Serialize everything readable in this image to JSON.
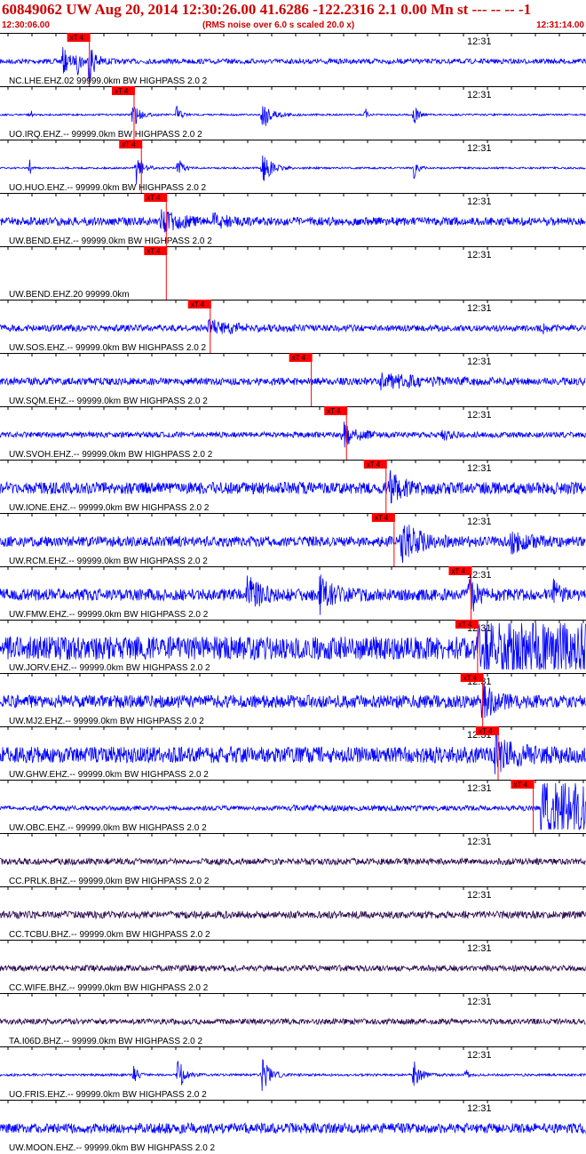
{
  "header": {
    "title": "60849062 UW Aug 20, 2014 12:30:26.00   41.6286 -122.2316  2.1 0.00 Mn st --- -- --  -1",
    "start_time": "12:30:06.00",
    "rms_note": "(RMS noise over 6.0 s scaled 20.0 x)",
    "end_time": "12:31:14.00"
  },
  "colors": {
    "header": "#cc0000",
    "trace": "#0000ff",
    "trace_cc": "#2a0a50",
    "pick": "#ff0000",
    "label": "#000000"
  },
  "chart_data": {
    "type": "line",
    "time_window": [
      "12:30:06.00",
      "12:31:14.00"
    ],
    "time_marker": "12:31",
    "pick_label": "xT 4",
    "traces": [
      {
        "label": "NC.LHE.EHZ.02  99999.0km BW  HIGHPASS  2.0  2",
        "pick_time_s": 12.2,
        "network_color": "trace",
        "noise": 0.11,
        "bursts": [
          [
            8.6,
            0.9,
            0.55
          ],
          [
            10.6,
            0.6,
            0.45
          ],
          [
            12.2,
            0.8,
            0.9
          ]
        ]
      },
      {
        "label": "UO.IRQ.EHZ.--  99999.0km BW  HIGHPASS  2.0  2",
        "pick_time_s": 18.3,
        "network_color": "trace",
        "noise": 0.04,
        "bursts": [
          [
            4.1,
            0.15,
            0.45
          ],
          [
            18.1,
            0.8,
            0.65
          ],
          [
            24.1,
            0.6,
            0.4
          ],
          [
            35.8,
            1.2,
            0.7
          ],
          [
            49.9,
            0.2,
            0.3
          ],
          [
            56.5,
            0.5,
            0.55
          ]
        ]
      },
      {
        "label": "UO.HUO.EHZ.--  99999.0km BW  HIGHPASS  2.0  2",
        "pick_time_s": 19.3,
        "network_color": "trace",
        "noise": 0.04,
        "bursts": [
          [
            4.1,
            0.15,
            0.4
          ],
          [
            18.6,
            0.8,
            0.7
          ],
          [
            24.3,
            0.6,
            0.5
          ],
          [
            35.8,
            1.2,
            0.7
          ],
          [
            56.5,
            0.5,
            0.55
          ]
        ]
      },
      {
        "label": "UW.BEND.EHZ.--  99999.0km BW  HIGHPASS  2.0  2",
        "pick_time_s": 22.7,
        "network_color": "trace",
        "noise": 0.18,
        "bursts": [
          [
            22.1,
            2.0,
            0.55
          ],
          [
            29.2,
            1.5,
            0.32
          ]
        ]
      },
      {
        "label": "UW.BEND.EHZ.20  99999.0km",
        "pick_time_s": 22.7,
        "network_color": "trace",
        "noise": 0.0,
        "bursts": []
      },
      {
        "label": "UW.SOS.EHZ.--  99999.0km BW  HIGHPASS  2.0  2",
        "pick_time_s": 28.7,
        "network_color": "trace",
        "noise": 0.14,
        "bursts": [
          [
            28.5,
            3.5,
            0.28
          ],
          [
            74.0,
            0.6,
            0.2
          ]
        ]
      },
      {
        "label": "UW.SQM.EHZ.--  99999.0km BW  HIGHPASS  2.0  2",
        "pick_time_s": 42.5,
        "network_color": "trace",
        "noise": 0.16,
        "bursts": [
          [
            52.0,
            6.0,
            0.25
          ]
        ]
      },
      {
        "label": "UW.SVOH.EHZ.--  99999.0km BW  HIGHPASS  2.0  2",
        "pick_time_s": 47.3,
        "network_color": "trace",
        "noise": 0.12,
        "bursts": [
          [
            46.8,
            1.6,
            0.6
          ],
          [
            60.5,
            1.0,
            0.2
          ]
        ]
      },
      {
        "label": "UW.IONE.EHZ.--  99999.0km BW  HIGHPASS  2.0  2",
        "pick_time_s": 52.7,
        "network_color": "trace",
        "noise": 0.26,
        "bursts": [
          [
            53.2,
            2.0,
            0.55
          ]
        ]
      },
      {
        "label": "UW.RCM.EHZ.--  99999.0km BW  HIGHPASS  2.0  2",
        "pick_time_s": 53.8,
        "network_color": "trace",
        "noise": 0.22,
        "bursts": [
          [
            54.8,
            2.2,
            0.85
          ],
          [
            69.8,
            2.0,
            0.4
          ]
        ]
      },
      {
        "label": "UW.FMW.EHZ.--  99999.0km BW  HIGHPASS  2.0  2",
        "pick_time_s": 64.3,
        "network_color": "trace",
        "noise": 0.26,
        "bursts": [
          [
            33.8,
            1.6,
            0.8
          ],
          [
            43.6,
            1.6,
            0.8
          ],
          [
            64.1,
            0.9,
            0.9
          ],
          [
            75.5,
            0.8,
            0.55
          ]
        ]
      },
      {
        "label": "UW.JORV.EHZ.--  99999.0km BW  HIGHPASS  2.0  2",
        "pick_time_s": 65.2,
        "network_color": "trace",
        "noise": 0.5,
        "bursts": [],
        "clip_from_s": 65.2
      },
      {
        "label": "UW.MJ2.EHZ.--  99999.0km BW  HIGHPASS  2.0  2",
        "pick_time_s": 65.9,
        "network_color": "trace",
        "noise": 0.28,
        "bursts": [
          [
            65.8,
            1.5,
            0.75
          ]
        ]
      },
      {
        "label": "UW.GHW.EHZ.--  99999.0km BW  HIGHPASS  2.0  2",
        "pick_time_s": 68.0,
        "network_color": "trace",
        "noise": 0.35,
        "bursts": [
          [
            67.6,
            2.5,
            0.7
          ]
        ]
      },
      {
        "label": "UW.OBC.EHZ.--  99999.0km BW  HIGHPASS  2.0  2",
        "pick_time_s": 72.8,
        "network_color": "trace",
        "noise": 0.1,
        "bursts": [
          [
            40,
            20,
            0.04
          ]
        ],
        "clip_from_s": 73.8
      },
      {
        "label": "CC.PRLK.BHZ.--  99999.0km BW  HIGHPASS  2.0  2",
        "pick_time_s": null,
        "network_color": "trace_cc",
        "noise": 0.14,
        "bursts": []
      },
      {
        "label": "CC.TCBU.BHZ.--  99999.0km BW  HIGHPASS  2.0  2",
        "pick_time_s": null,
        "network_color": "trace_cc",
        "noise": 0.16,
        "bursts": []
      },
      {
        "label": "CC.WIFE.BHZ.--  99999.0km BW  HIGHPASS  2.0  2",
        "pick_time_s": null,
        "network_color": "trace_cc",
        "noise": 0.13,
        "bursts": []
      },
      {
        "label": "TA.I06D.BHZ.--  99999.0km BW  HIGHPASS  2.0  2",
        "pick_time_s": null,
        "network_color": "trace_cc",
        "noise": 0.12,
        "bursts": []
      },
      {
        "label": "UO.FRIS.EHZ.--  99999.0km BW  HIGHPASS  2.0  2",
        "pick_time_s": null,
        "network_color": "trace",
        "noise": 0.05,
        "bursts": [
          [
            18.3,
            0.5,
            0.45
          ],
          [
            24.3,
            0.8,
            0.75
          ],
          [
            35.8,
            1.0,
            0.75
          ],
          [
            56.5,
            0.8,
            0.7
          ],
          [
            63.6,
            0.3,
            0.3
          ]
        ]
      },
      {
        "label": "UW.MOON.EHZ.--  99999.0km BW  HIGHPASS  2.0  2",
        "pick_time_s": null,
        "network_color": "trace",
        "noise": 0.22,
        "bursts": []
      }
    ]
  }
}
